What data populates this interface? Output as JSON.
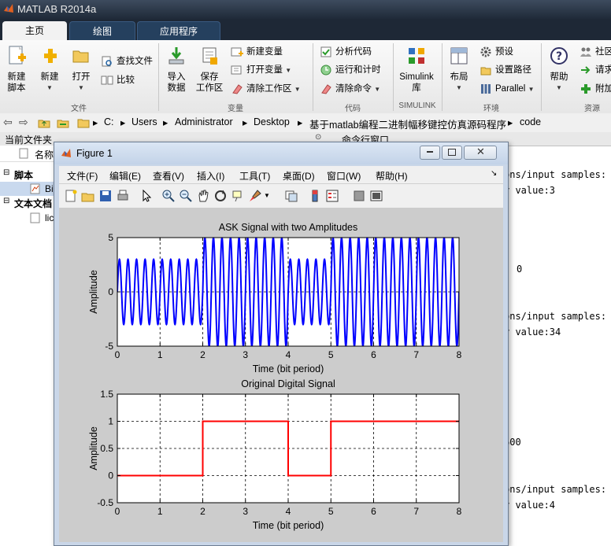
{
  "app": {
    "title": "MATLAB R2014a"
  },
  "tabs": [
    {
      "label": "主页",
      "active": true
    },
    {
      "label": "绘图",
      "active": false
    },
    {
      "label": "应用程序",
      "active": false
    }
  ],
  "ribbon": {
    "file": {
      "new_script": [
        "新建",
        "脚本"
      ],
      "new": "新建",
      "open": "打开",
      "find_files": "查找文件",
      "compare": "比较",
      "group": "文件"
    },
    "variable": {
      "import": [
        "导入",
        "数据"
      ],
      "save_ws": [
        "保存",
        "工作区"
      ],
      "new_var": "新建变量",
      "open_var": "打开变量",
      "clear_ws": "清除工作区",
      "group": "变量"
    },
    "code": {
      "analyze": "分析代码",
      "run_time": "运行和计时",
      "clear_cmd": "清除命令",
      "group": "代码"
    },
    "simulink": {
      "label": [
        "Simulink",
        "库"
      ],
      "group": "SIMULINK"
    },
    "env": {
      "layout": "布局",
      "prefs": "预设",
      "set_path": "设置路径",
      "parallel": "Parallel",
      "group": "环境"
    },
    "resources": {
      "help": "帮助",
      "community": "社区",
      "request": "请求",
      "addons": "附加",
      "group": "资源"
    }
  },
  "address": {
    "crumbs": [
      "C:",
      "Users",
      "Administrator",
      "Desktop",
      "基于matlab编程二进制幅移键控仿真源码程序",
      "code"
    ]
  },
  "current_folder": {
    "title": "当前文件夹",
    "name_col": "名称",
    "sections": [
      {
        "label": "脚本",
        "item": "Bi"
      },
      {
        "label": "文本文档",
        "item": "lic"
      }
    ]
  },
  "command_window": {
    "title": "命令行窗口",
    "lines": [
      {
        "text": "ons/input samples:",
        "top": 215
      },
      {
        "text": "r value:3",
        "top": 235
      },
      {
        "text": "0",
        "top": 335
      },
      {
        "text": "ons/input samples:",
        "top": 395
      },
      {
        "text": "r value:34",
        "top": 415
      },
      {
        "text": "600",
        "top": 555
      },
      {
        "text": "ons/input samples:",
        "top": 615
      },
      {
        "text": "r value:4",
        "top": 635
      }
    ]
  },
  "figure": {
    "title": "Figure 1",
    "menus": [
      "文件(F)",
      "编辑(E)",
      "查看(V)",
      "插入(I)",
      "工具(T)",
      "桌面(D)",
      "窗口(W)",
      "帮助(H)"
    ]
  },
  "chart_data": [
    {
      "type": "line",
      "title": "ASK Signal with two Amplitudes",
      "xlabel": "Time (bit period)",
      "ylabel": "Amplitude",
      "xlim": [
        0,
        8
      ],
      "ylim": [
        -5,
        5
      ],
      "xticks": [
        0,
        1,
        2,
        3,
        4,
        5,
        6,
        7,
        8
      ],
      "yticks": [
        -5,
        0,
        5
      ],
      "grid": true,
      "color": "#0000ff",
      "bits": [
        0,
        0,
        1,
        1,
        0,
        1,
        1,
        1
      ],
      "amplitude_bit0": 3,
      "amplitude_bit1": 5,
      "cycles_per_bit": 5
    },
    {
      "type": "line",
      "title": "Original Digital Signal",
      "xlabel": "Time (bit period)",
      "ylabel": "Amplitude",
      "xlim": [
        0,
        8
      ],
      "ylim": [
        -0.5,
        1.5
      ],
      "xticks": [
        0,
        1,
        2,
        3,
        4,
        5,
        6,
        7,
        8
      ],
      "yticks": [
        -0.5,
        0,
        0.5,
        1,
        1.5
      ],
      "grid": true,
      "color": "#ff0000",
      "x": [
        0,
        2,
        2,
        4,
        4,
        5,
        5,
        8
      ],
      "y": [
        0,
        0,
        1,
        1,
        0,
        0,
        1,
        1
      ]
    }
  ]
}
